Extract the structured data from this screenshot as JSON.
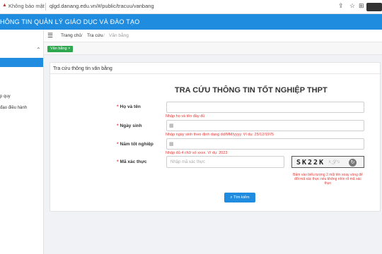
{
  "browser": {
    "security_label": "Không bảo mật",
    "url": "qlgd.danang.edu.vn/#/public/tracuu/vanbang"
  },
  "header": {
    "title": "HÔNG TIN QUẢN LÝ GIÁO DỤC VÀ ĐÀO TẠO"
  },
  "sidebar": {
    "items": [
      {
        "label": "p quy"
      },
      {
        "label": "đạo điều hành"
      }
    ]
  },
  "breadcrumb": {
    "home": "Trang chủ",
    "sep1": "/",
    "lookup": "Tra cứu",
    "sep2": "/",
    "current": "Văn bằng"
  },
  "tabs": {
    "active_label": "Văn bằng ×"
  },
  "card": {
    "header": "Tra cứu thông tin văn bằng",
    "form_title": "TRA CỨU THÔNG TIN TỐT NGHIỆP THPT"
  },
  "form": {
    "required_mark": "*",
    "name_label": "Họ và tên",
    "name_error": "Nhập họ và tên đầy đủ",
    "dob_label": "Ngày sinh",
    "dob_error": "Nhập ngày sinh theo định dạng dd/MM/yyyy. Ví dụ: 25/12/1975",
    "year_label": "Năm tốt nghiệp",
    "year_error": "Nhập đủ 4 chữ số xxxx. Ví dụ: 2023",
    "captcha_label": "Mã xác thực",
    "captcha_placeholder": "Nhập mã xác thực",
    "captcha_code": "SK22K",
    "captcha_hint": "Bấm vào biểu tượng 2 mũi tên xoay vòng để đổi mã xác thực nếu không nhìn rõ mã xác thực",
    "search_label": "Tìm kiếm"
  }
}
